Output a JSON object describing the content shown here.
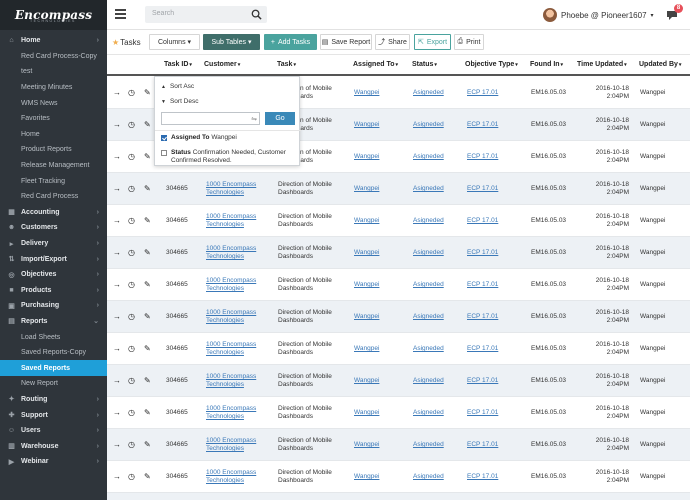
{
  "brand": {
    "logo_text": "Encompass",
    "logo_sub": "TECHNOLOGIES"
  },
  "sidebar": {
    "items": [
      {
        "label": "Home",
        "type": "main",
        "icon": "home-icon",
        "glyph": "⌂",
        "chev": "›"
      },
      {
        "label": "Red Card Process-Copy",
        "type": "sub"
      },
      {
        "label": "test",
        "type": "sub"
      },
      {
        "label": "Meeting Minutes",
        "type": "sub"
      },
      {
        "label": "WMS News",
        "type": "sub"
      },
      {
        "label": "Favorites",
        "type": "sub"
      },
      {
        "label": "Home",
        "type": "sub"
      },
      {
        "label": "Product Reports",
        "type": "sub"
      },
      {
        "label": "Release Management",
        "type": "sub"
      },
      {
        "label": "Fleet Tracking",
        "type": "sub"
      },
      {
        "label": "Red Card Process",
        "type": "sub"
      },
      {
        "label": "Accounting",
        "type": "main",
        "icon": "accounting-icon",
        "glyph": "▦",
        "chev": "›"
      },
      {
        "label": "Customers",
        "type": "main",
        "icon": "customers-icon",
        "glyph": "☻",
        "chev": "›"
      },
      {
        "label": "Delivery",
        "type": "main",
        "icon": "delivery-icon",
        "glyph": "▸",
        "chev": "›"
      },
      {
        "label": "Import/Export",
        "type": "main",
        "icon": "import-export-icon",
        "glyph": "⇅",
        "chev": "›"
      },
      {
        "label": "Objectives",
        "type": "main",
        "icon": "objectives-icon",
        "glyph": "◎",
        "chev": "›"
      },
      {
        "label": "Products",
        "type": "main",
        "icon": "products-icon",
        "glyph": "■",
        "chev": "›"
      },
      {
        "label": "Purchasing",
        "type": "main",
        "icon": "purchasing-icon",
        "glyph": "▣",
        "chev": "›"
      },
      {
        "label": "Reports",
        "type": "main",
        "icon": "reports-icon",
        "glyph": "▤",
        "chev": "⌄"
      },
      {
        "label": "Load Sheets",
        "type": "sub"
      },
      {
        "label": "Saved Reports-Copy",
        "type": "sub"
      },
      {
        "label": "Saved Reports",
        "type": "sub",
        "active": true
      },
      {
        "label": "New Report",
        "type": "sub"
      },
      {
        "label": "Routing",
        "type": "main",
        "icon": "routing-icon",
        "glyph": "✦",
        "chev": "›"
      },
      {
        "label": "Support",
        "type": "main",
        "icon": "support-icon",
        "glyph": "✚",
        "chev": "›"
      },
      {
        "label": "Users",
        "type": "main",
        "icon": "users-icon",
        "glyph": "☺",
        "chev": "›"
      },
      {
        "label": "Warehouse",
        "type": "main",
        "icon": "warehouse-icon",
        "glyph": "▥",
        "chev": "›"
      },
      {
        "label": "Webinar",
        "type": "main",
        "icon": "webinar-icon",
        "glyph": "▶",
        "chev": "›"
      }
    ]
  },
  "topbar": {
    "search_placeholder": "Search",
    "user_name": "Phoebe @ Pioneer1607",
    "user_caret": "▾",
    "notification_count": "8"
  },
  "toolbar": {
    "title": "Tasks",
    "star": "★",
    "columns_label": "Columns",
    "subtables_label": "Sub Tables",
    "add_tasks_label": "Add Tasks",
    "save_report_label": "Save Report",
    "share_label": "Share",
    "export_label": "Export",
    "print_label": "Print",
    "caret": "▾",
    "plus": "+",
    "save_glyph": "▤",
    "share_glyph": "⤴",
    "export_glyph": "⇱",
    "print_glyph": "⎙"
  },
  "table": {
    "sort_arrow": "▾",
    "columns": [
      "Task ID",
      "Customer",
      "Task",
      "Assigned To",
      "Status",
      "Objective Type",
      "Found In",
      "Time Updated",
      "Updated By"
    ],
    "row_icons": {
      "open": "→",
      "history": "◷",
      "edit": "✎"
    },
    "rows": [
      {
        "id": "",
        "customer": "",
        "task": "Direction of Mobile Dashboards",
        "assigned": "Wangpei",
        "status": "Asigneded",
        "objective": "ECP 17.01",
        "found": "EM16.05.03",
        "date": "2016-10-18",
        "time": "2:04PM",
        "updated_by": "Wangpei"
      },
      {
        "id": "",
        "customer": "",
        "task": "Direction of Mobile Dashboards",
        "assigned": "Wangpei",
        "status": "Asigneded",
        "objective": "ECP 17.01",
        "found": "EM16.05.03",
        "date": "2016-10-18",
        "time": "2:04PM",
        "updated_by": "Wangpei"
      },
      {
        "id": "",
        "customer": "",
        "task": "Direction of Mobile Dashboards",
        "assigned": "Wangpei",
        "status": "Asigneded",
        "objective": "ECP 17.01",
        "found": "EM16.05.03",
        "date": "2016-10-18",
        "time": "2:04PM",
        "updated_by": "Wangpei"
      },
      {
        "id": "304665",
        "customer": "1000 Encompass Technologies",
        "task": "Direction of Mobile Dashboards",
        "assigned": "Wangpei",
        "status": "Asigneded",
        "objective": "ECP 17.01",
        "found": "EM16.05.03",
        "date": "2016-10-18",
        "time": "2:04PM",
        "updated_by": "Wangpei"
      },
      {
        "id": "304665",
        "customer": "1000 Encompass Technologies",
        "task": "Direction of Mobile Dashboards",
        "assigned": "Wangpei",
        "status": "Asigneded",
        "objective": "ECP 17.01",
        "found": "EM16.05.03",
        "date": "2016-10-18",
        "time": "2:04PM",
        "updated_by": "Wangpei"
      },
      {
        "id": "304665",
        "customer": "1000 Encompass Technologies",
        "task": "Direction of Mobile Dashboards",
        "assigned": "Wangpei",
        "status": "Asigneded",
        "objective": "ECP 17.01",
        "found": "EM16.05.03",
        "date": "2016-10-18",
        "time": "2:04PM",
        "updated_by": "Wangpei"
      },
      {
        "id": "304665",
        "customer": "1000 Encompass Technologies",
        "task": "Direction of Mobile Dashboards",
        "assigned": "Wangpei",
        "status": "Asigneded",
        "objective": "ECP 17.01",
        "found": "EM16.05.03",
        "date": "2016-10-18",
        "time": "2:04PM",
        "updated_by": "Wangpei"
      },
      {
        "id": "304665",
        "customer": "1000 Encompass Technologies",
        "task": "Direction of Mobile Dashboards",
        "assigned": "Wangpei",
        "status": "Asigneded",
        "objective": "ECP 17.01",
        "found": "EM16.05.03",
        "date": "2016-10-18",
        "time": "2:04PM",
        "updated_by": "Wangpei"
      },
      {
        "id": "304665",
        "customer": "1000 Encompass Technologies",
        "task": "Direction of Mobile Dashboards",
        "assigned": "Wangpei",
        "status": "Asigneded",
        "objective": "ECP 17.01",
        "found": "EM16.05.03",
        "date": "2016-10-18",
        "time": "2:04PM",
        "updated_by": "Wangpei"
      },
      {
        "id": "304665",
        "customer": "1000 Encompass Technologies",
        "task": "Direction of Mobile Dashboards",
        "assigned": "Wangpei",
        "status": "Asigneded",
        "objective": "ECP 17.01",
        "found": "EM16.05.03",
        "date": "2016-10-18",
        "time": "2:04PM",
        "updated_by": "Wangpei"
      },
      {
        "id": "304665",
        "customer": "1000 Encompass Technologies",
        "task": "Direction of Mobile Dashboards",
        "assigned": "Wangpei",
        "status": "Asigneded",
        "objective": "ECP 17.01",
        "found": "EM16.05.03",
        "date": "2016-10-18",
        "time": "2:04PM",
        "updated_by": "Wangpei"
      },
      {
        "id": "304665",
        "customer": "1000 Encompass Technologies",
        "task": "Direction of Mobile Dashboards",
        "assigned": "Wangpei",
        "status": "Asigneded",
        "objective": "ECP 17.01",
        "found": "EM16.05.03",
        "date": "2016-10-18",
        "time": "2:04PM",
        "updated_by": "Wangpei"
      },
      {
        "id": "304665",
        "customer": "1000 Encompass Technologies",
        "task": "Direction of Mobile Dashboards",
        "assigned": "Wangpei",
        "status": "Asigneded",
        "objective": "ECP 17.01",
        "found": "EM16.05.03",
        "date": "2016-10-18",
        "time": "2:04PM",
        "updated_by": "Wangpei"
      },
      {
        "id": "304665",
        "customer": "1000 Encompass Technologies",
        "task": "Direction of Mobile Dashboards",
        "assigned": "Wangpei",
        "status": "Asigneded",
        "objective": "ECP 17.01",
        "found": "EM16.05.03",
        "date": "2016-10-18",
        "time": "2:04PM",
        "updated_by": "Wangpei"
      }
    ]
  },
  "filter_popup": {
    "sort_asc": "Sort Asc",
    "sort_desc": "Sort Desc",
    "tri_up": "▲",
    "tri_down": "▼",
    "filter_icon_glyph": "⇋",
    "go_label": "Go",
    "options": [
      {
        "checked": true,
        "field": "Assigned To",
        "value": "Wangpei"
      },
      {
        "checked": false,
        "field": "Status",
        "value": "Confirmation Needed, Customer Confirmed Resolved."
      }
    ]
  }
}
